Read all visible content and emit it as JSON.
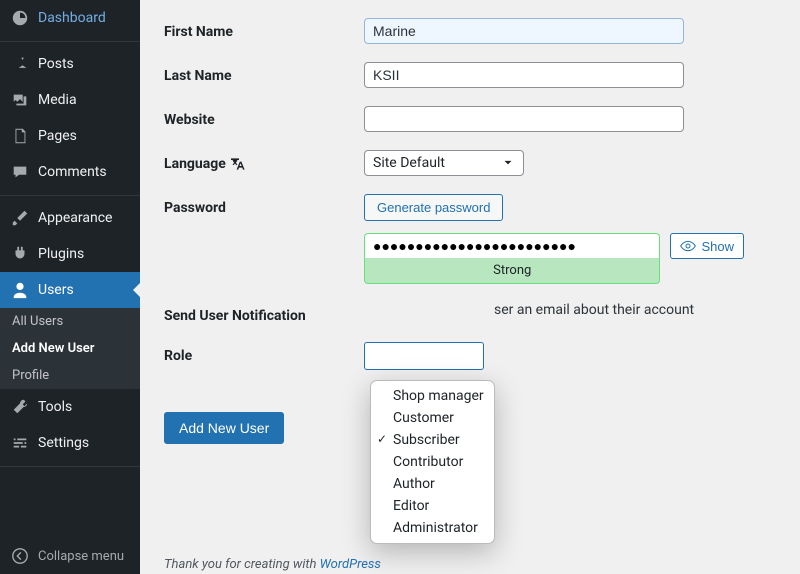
{
  "sidebar": {
    "items": [
      {
        "id": "dashboard",
        "label": "Dashboard"
      },
      {
        "id": "posts",
        "label": "Posts"
      },
      {
        "id": "media",
        "label": "Media"
      },
      {
        "id": "pages",
        "label": "Pages"
      },
      {
        "id": "comments",
        "label": "Comments"
      },
      {
        "id": "appearance",
        "label": "Appearance"
      },
      {
        "id": "plugins",
        "label": "Plugins"
      },
      {
        "id": "users",
        "label": "Users"
      },
      {
        "id": "tools",
        "label": "Tools"
      },
      {
        "id": "settings",
        "label": "Settings"
      }
    ],
    "users_submenu": [
      {
        "id": "all-users",
        "label": "All Users"
      },
      {
        "id": "add-new-user",
        "label": "Add New User"
      },
      {
        "id": "profile",
        "label": "Profile"
      }
    ],
    "collapse_label": "Collapse menu"
  },
  "form": {
    "first_name": {
      "label": "First Name",
      "value": "Marine"
    },
    "last_name": {
      "label": "Last Name",
      "value": "KSII"
    },
    "website": {
      "label": "Website",
      "value": ""
    },
    "language": {
      "label": "Language",
      "value": "Site Default"
    },
    "password": {
      "label": "Password",
      "generate_btn": "Generate password",
      "masked": "●●●●●●●●●●●●●●●●●●●●●●●●",
      "strength": "Strong",
      "show_btn": "Show"
    },
    "notification": {
      "label": "Send User Notification",
      "text_suffix": "ser an email about their account"
    },
    "role": {
      "label": "Role",
      "selected_index": 2,
      "options": [
        "Shop manager",
        "Customer",
        "Subscriber",
        "Contributor",
        "Author",
        "Editor",
        "Administrator"
      ]
    },
    "submit_btn": "Add New User"
  },
  "footer": {
    "prefix": "Thank you for creating with ",
    "link": "WordPress"
  }
}
